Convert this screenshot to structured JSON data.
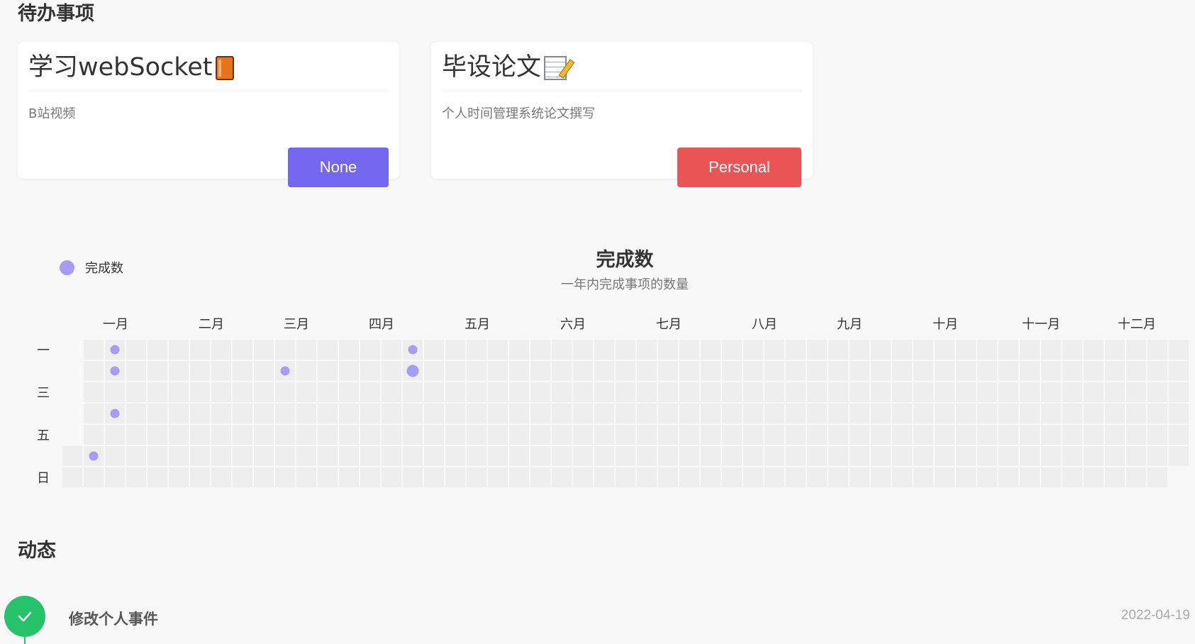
{
  "todo": {
    "section_title": "待办事项",
    "cards": [
      {
        "title": "学习webSocket",
        "emoji_icon": "book-icon",
        "description": "B站视频",
        "tag": "None",
        "tag_color": "#7467ef"
      },
      {
        "title": "毕设论文",
        "emoji_icon": "memo-icon",
        "description": "个人时间管理系统论文撰写",
        "tag": "Personal",
        "tag_color": "#ea5455"
      }
    ]
  },
  "chart_data": {
    "type": "heatmap",
    "title": "完成数",
    "subtitle": "一年内完成事项的数量",
    "legend": [
      {
        "name": "完成数",
        "color": "#a59cf3"
      }
    ],
    "legend_position": "top-left",
    "year": 2022,
    "months": [
      "一月",
      "二月",
      "三月",
      "四月",
      "五月",
      "六月",
      "七月",
      "八月",
      "九月",
      "十月",
      "十一月",
      "十二月"
    ],
    "weekday_labels": [
      "一",
      "",
      "三",
      "",
      "五",
      "",
      "日"
    ],
    "cell_color": "#eeeeee",
    "point_color": "#a59cf3",
    "points": [
      {
        "date": "2022-01-08",
        "value": 1
      },
      {
        "date": "2022-01-10",
        "value": 1
      },
      {
        "date": "2022-01-11",
        "value": 1
      },
      {
        "date": "2022-01-13",
        "value": 1
      },
      {
        "date": "2022-03-08",
        "value": 1
      },
      {
        "date": "2022-04-18",
        "value": 1
      },
      {
        "date": "2022-04-19",
        "value": 2
      }
    ]
  },
  "activity": {
    "section_title": "动态",
    "items": [
      {
        "title": "修改个人事件",
        "date": "2022-04-19",
        "status_icon": "check-icon",
        "status_color": "#27c26a"
      }
    ]
  }
}
